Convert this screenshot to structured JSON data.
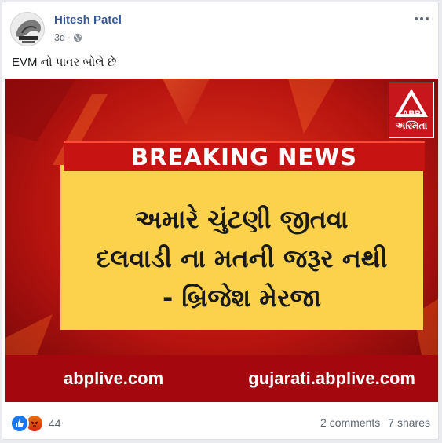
{
  "post": {
    "author": "Hitesh Patel",
    "time": "3d",
    "text": "EVM નો પાવર બોલે છે"
  },
  "image": {
    "channel_logo_text": "ABP",
    "channel_sub": "અસ્મિતા",
    "breaking_label": "BREAKING NEWS",
    "quote_lines": [
      "અમારે ચુંટણી જીતવા",
      "દલવાડી ના મતની જરૂર નથી",
      "- બ્રિજેશ મેરજા"
    ],
    "footer_left": "abplive.com",
    "footer_right": "gujarati.abplive.com"
  },
  "reactions": {
    "count": "44",
    "comments": "2 comments",
    "shares": "7 shares"
  },
  "colors": {
    "author_link": "#385898",
    "breaking_red": "#c81313",
    "banner_yellow": "#fcd24d",
    "footer_red": "#a4070e"
  }
}
